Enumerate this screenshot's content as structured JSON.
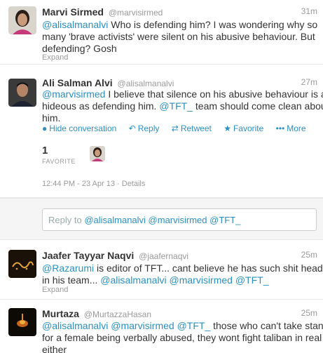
{
  "tweets": [
    {
      "name": "Marvi Sirmed",
      "handle": "@marvisirmed",
      "time": "31m",
      "text_lines": [
        [
          {
            "t": "@alisalmanalvi",
            "link": true
          },
          {
            "t": " Who is defending him? I was wondering why so",
            "link": false
          }
        ],
        [
          {
            "t": "many 'brave activists' were silent on his abusive behaviour. But",
            "link": false
          }
        ],
        [
          {
            "t": "defending? Gosh",
            "link": false
          }
        ]
      ],
      "expand": "Expand"
    },
    {
      "name": "Ali Salman Alvi",
      "handle": "@alisalmanalvi",
      "time": "27m",
      "text_lines": [
        [
          {
            "t": "@marvisirmed",
            "link": true
          },
          {
            "t": " I believe that silence on his abusive behaviour is as",
            "link": false
          }
        ],
        [
          {
            "t": "hideous as defending him. ",
            "link": false
          },
          {
            "t": "@TFT_",
            "link": true
          },
          {
            "t": " team should come clean about",
            "link": false
          }
        ],
        [
          {
            "t": "him.",
            "link": false
          }
        ]
      ],
      "actions": {
        "hide": "Hide conversation",
        "reply": "Reply",
        "retweet": "Retweet",
        "favorite": "Favorite",
        "more": "More"
      },
      "fav_count": "1",
      "fav_label": "FAVORITE",
      "timestamp": "12:44 PM - 23 Apr 13",
      "details": "Details"
    },
    {
      "name": "Jaafer Tayyar Naqvi",
      "handle": "@jaafernaqvi",
      "time": "25m",
      "text_lines": [
        [
          {
            "t": "@Razarumi",
            "link": true
          },
          {
            "t": " is editor of TFT... cant believe he has such shit heads",
            "link": false
          }
        ],
        [
          {
            "t": "in his team... ",
            "link": false
          },
          {
            "t": "@alisalmanalvi @marvisirmed @TFT_",
            "link": true
          }
        ]
      ],
      "expand": "Expand"
    },
    {
      "name": "Murtaza",
      "handle": "@MurtazzaHasan",
      "time": "25m",
      "text_lines": [
        [
          {
            "t": "@alisalmanalvi @marvisirmed @TFT_",
            "link": true
          },
          {
            "t": "  those who can't take stand",
            "link": false
          }
        ],
        [
          {
            "t": "for a female being verbally abused, they wont fight taliban in real life",
            "link": false
          }
        ],
        [
          {
            "t": "either",
            "link": false
          }
        ]
      ]
    }
  ],
  "reply_box": {
    "prefix": "Reply to ",
    "mentions": "@alisalmanalvi @marvisirmed @TFT_"
  },
  "colors": {
    "link": "#2a8fbf",
    "muted": "#999999",
    "text": "#333333"
  }
}
